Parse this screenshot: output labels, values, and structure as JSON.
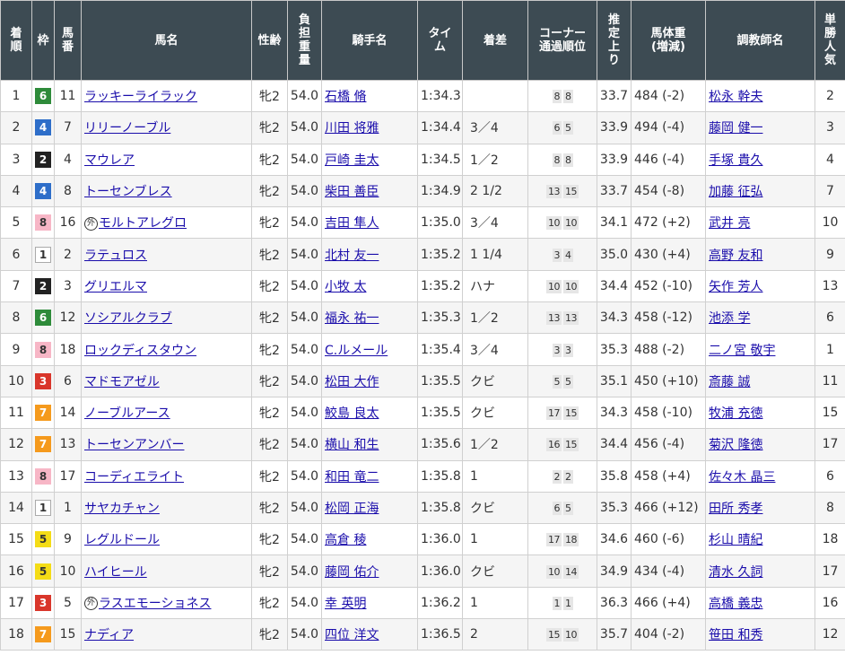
{
  "headers": {
    "rank": "着\n順",
    "waku": "枠",
    "umaban": "馬\n番",
    "horse": "馬名",
    "sexage": "性齢",
    "weight": "負\n担\n重\n量",
    "jockey": "騎手名",
    "time": "タイ\nム",
    "margin": "着差",
    "corner": "コーナー\n通過順位",
    "last3f": "推\n定\n上\nり",
    "body": "馬体重\n(増減)",
    "trainer": "調教師名",
    "pop": "単\n勝\n人\n気"
  },
  "foreign_mark": "外",
  "rows": [
    {
      "rank": "1",
      "waku": "6",
      "umaban": "11",
      "mark": false,
      "horse": "ラッキーライラック",
      "sexage": "牝2",
      "weight": "54.0",
      "jockey": "石橋 脩",
      "time": "1:34.3",
      "margin": "",
      "c1": "8",
      "c2": "8",
      "last3f": "33.7",
      "body": "484 (-2)",
      "trainer": "松永 幹夫",
      "pop": "2"
    },
    {
      "rank": "2",
      "waku": "4",
      "umaban": "7",
      "mark": false,
      "horse": "リリーノーブル",
      "sexage": "牝2",
      "weight": "54.0",
      "jockey": "川田 将雅",
      "time": "1:34.4",
      "margin": "3／4",
      "c1": "6",
      "c2": "5",
      "last3f": "33.9",
      "body": "494 (-4)",
      "trainer": "藤岡 健一",
      "pop": "3"
    },
    {
      "rank": "3",
      "waku": "2",
      "umaban": "4",
      "mark": false,
      "horse": "マウレア",
      "sexage": "牝2",
      "weight": "54.0",
      "jockey": "戸崎 圭太",
      "time": "1:34.5",
      "margin": "1／2",
      "c1": "8",
      "c2": "8",
      "last3f": "33.9",
      "body": "446 (-4)",
      "trainer": "手塚 貴久",
      "pop": "4"
    },
    {
      "rank": "4",
      "waku": "4",
      "umaban": "8",
      "mark": false,
      "horse": "トーセンブレス",
      "sexage": "牝2",
      "weight": "54.0",
      "jockey": "柴田 善臣",
      "time": "1:34.9",
      "margin": "2 1/2",
      "c1": "13",
      "c2": "15",
      "last3f": "33.7",
      "body": "454 (-8)",
      "trainer": "加藤 征弘",
      "pop": "7"
    },
    {
      "rank": "5",
      "waku": "8",
      "umaban": "16",
      "mark": true,
      "horse": "モルトアレグロ",
      "sexage": "牝2",
      "weight": "54.0",
      "jockey": "吉田 隼人",
      "time": "1:35.0",
      "margin": "3／4",
      "c1": "10",
      "c2": "10",
      "last3f": "34.1",
      "body": "472 (+2)",
      "trainer": "武井 亮",
      "pop": "10"
    },
    {
      "rank": "6",
      "waku": "1",
      "umaban": "2",
      "mark": false,
      "horse": "ラテュロス",
      "sexage": "牝2",
      "weight": "54.0",
      "jockey": "北村 友一",
      "time": "1:35.2",
      "margin": "1 1/4",
      "c1": "3",
      "c2": "4",
      "last3f": "35.0",
      "body": "430 (+4)",
      "trainer": "高野 友和",
      "pop": "9"
    },
    {
      "rank": "7",
      "waku": "2",
      "umaban": "3",
      "mark": false,
      "horse": "グリエルマ",
      "sexage": "牝2",
      "weight": "54.0",
      "jockey": "小牧 太",
      "time": "1:35.2",
      "margin": "ハナ",
      "c1": "10",
      "c2": "10",
      "last3f": "34.4",
      "body": "452 (-10)",
      "trainer": "矢作 芳人",
      "pop": "13"
    },
    {
      "rank": "8",
      "waku": "6",
      "umaban": "12",
      "mark": false,
      "horse": "ソシアルクラブ",
      "sexage": "牝2",
      "weight": "54.0",
      "jockey": "福永 祐一",
      "time": "1:35.3",
      "margin": "1／2",
      "c1": "13",
      "c2": "13",
      "last3f": "34.3",
      "body": "458 (-12)",
      "trainer": "池添 学",
      "pop": "6"
    },
    {
      "rank": "9",
      "waku": "8",
      "umaban": "18",
      "mark": false,
      "horse": "ロックディスタウン",
      "sexage": "牝2",
      "weight": "54.0",
      "jockey": "C.ルメール",
      "time": "1:35.4",
      "margin": "3／4",
      "c1": "3",
      "c2": "3",
      "last3f": "35.3",
      "body": "488 (-2)",
      "trainer": "二ノ宮 敬宇",
      "pop": "1"
    },
    {
      "rank": "10",
      "waku": "3",
      "umaban": "6",
      "mark": false,
      "horse": "マドモアゼル",
      "sexage": "牝2",
      "weight": "54.0",
      "jockey": "松田 大作",
      "time": "1:35.5",
      "margin": "クビ",
      "c1": "5",
      "c2": "5",
      "last3f": "35.1",
      "body": "450 (+10)",
      "trainer": "斎藤 誠",
      "pop": "11"
    },
    {
      "rank": "11",
      "waku": "7",
      "umaban": "14",
      "mark": false,
      "horse": "ノーブルアース",
      "sexage": "牝2",
      "weight": "54.0",
      "jockey": "鮫島 良太",
      "time": "1:35.5",
      "margin": "クビ",
      "c1": "17",
      "c2": "15",
      "last3f": "34.3",
      "body": "458 (-10)",
      "trainer": "牧浦 充徳",
      "pop": "15"
    },
    {
      "rank": "12",
      "waku": "7",
      "umaban": "13",
      "mark": false,
      "horse": "トーセンアンバー",
      "sexage": "牝2",
      "weight": "54.0",
      "jockey": "横山 和生",
      "time": "1:35.6",
      "margin": "1／2",
      "c1": "16",
      "c2": "15",
      "last3f": "34.4",
      "body": "456 (-4)",
      "trainer": "菊沢 隆徳",
      "pop": "17"
    },
    {
      "rank": "13",
      "waku": "8",
      "umaban": "17",
      "mark": false,
      "horse": "コーディエライト",
      "sexage": "牝2",
      "weight": "54.0",
      "jockey": "和田 竜二",
      "time": "1:35.8",
      "margin": "1",
      "c1": "2",
      "c2": "2",
      "last3f": "35.8",
      "body": "458 (+4)",
      "trainer": "佐々木 晶三",
      "pop": "6"
    },
    {
      "rank": "14",
      "waku": "1",
      "umaban": "1",
      "mark": false,
      "horse": "サヤカチャン",
      "sexage": "牝2",
      "weight": "54.0",
      "jockey": "松岡 正海",
      "time": "1:35.8",
      "margin": "クビ",
      "c1": "6",
      "c2": "5",
      "last3f": "35.3",
      "body": "466 (+12)",
      "trainer": "田所 秀孝",
      "pop": "8"
    },
    {
      "rank": "15",
      "waku": "5",
      "umaban": "9",
      "mark": false,
      "horse": "レグルドール",
      "sexage": "牝2",
      "weight": "54.0",
      "jockey": "高倉 稜",
      "time": "1:36.0",
      "margin": "1",
      "c1": "17",
      "c2": "18",
      "last3f": "34.6",
      "body": "460 (-6)",
      "trainer": "杉山 晴紀",
      "pop": "18"
    },
    {
      "rank": "16",
      "waku": "5",
      "umaban": "10",
      "mark": false,
      "horse": "ハイヒール",
      "sexage": "牝2",
      "weight": "54.0",
      "jockey": "藤岡 佑介",
      "time": "1:36.0",
      "margin": "クビ",
      "c1": "10",
      "c2": "14",
      "last3f": "34.9",
      "body": "434 (-4)",
      "trainer": "清水 久詞",
      "pop": "17"
    },
    {
      "rank": "17",
      "waku": "3",
      "umaban": "5",
      "mark": true,
      "horse": "ラスエモーショネス",
      "sexage": "牝2",
      "weight": "54.0",
      "jockey": "幸 英明",
      "time": "1:36.2",
      "margin": "1",
      "c1": "1",
      "c2": "1",
      "last3f": "36.3",
      "body": "466 (+4)",
      "trainer": "高橋 義忠",
      "pop": "16"
    },
    {
      "rank": "18",
      "waku": "7",
      "umaban": "15",
      "mark": false,
      "horse": "ナディア",
      "sexage": "牝2",
      "weight": "54.0",
      "jockey": "四位 洋文",
      "time": "1:36.5",
      "margin": "2",
      "c1": "15",
      "c2": "10",
      "last3f": "35.7",
      "body": "404 (-2)",
      "trainer": "笹田 和秀",
      "pop": "12"
    }
  ]
}
